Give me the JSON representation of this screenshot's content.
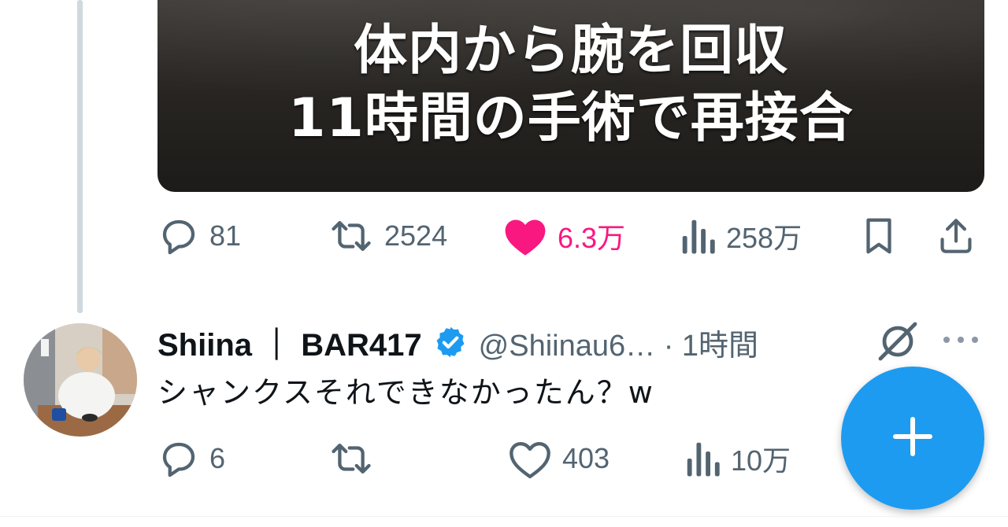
{
  "previous_tweet": {
    "media_text_lines": [
      "体内から腕を回収",
      "11時間の手術で再接合"
    ],
    "actions": {
      "reply_count": "81",
      "retweet_count": "2524",
      "like_count": "6.3万",
      "views_count": "258万"
    }
  },
  "reply_tweet": {
    "display_name": "Shiina ｜ BAR417",
    "handle_time": "@Shiinau6… · 1時間",
    "text": "シャンクスそれできなかったん？w",
    "actions": {
      "reply_count": "6",
      "retweet_count": "",
      "like_count": "403",
      "views_count": "10万"
    }
  },
  "colors": {
    "accent_blue": "#1d9bf0",
    "like_pink": "#f91880",
    "secondary_text": "#536471",
    "thread_line": "#cfd9de"
  },
  "icons": {
    "reply": "speech-bubble-icon",
    "retweet": "retweet-icon",
    "like": "heart-icon",
    "views": "bar-chart-icon",
    "bookmark": "bookmark-icon",
    "share": "share-icon",
    "verified": "verified-badge-icon",
    "grok": "grok-icon",
    "more": "more-dots-icon",
    "compose": "plus-icon"
  }
}
